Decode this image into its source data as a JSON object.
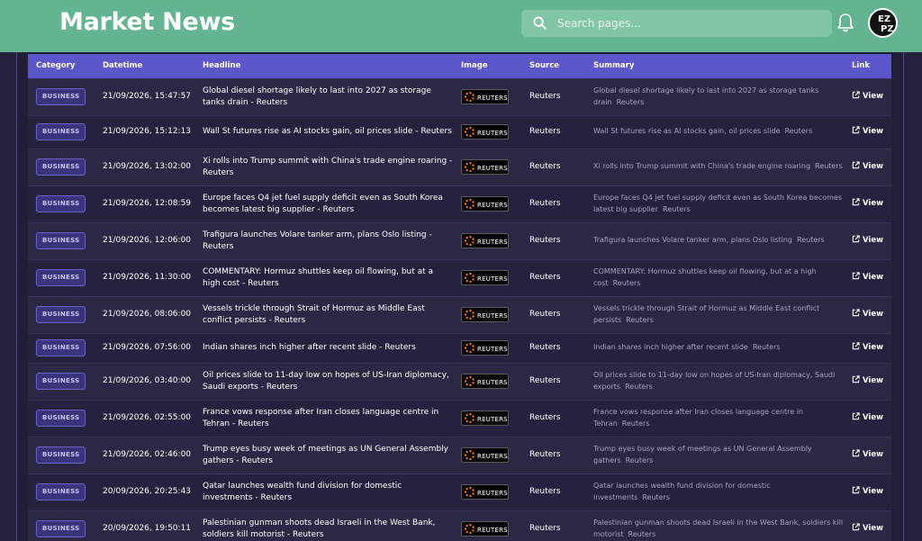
{
  "header": {
    "title": "Market News",
    "search_placeholder": "Search pages...",
    "avatar_line1": "EZ",
    "avatar_line2": "PZ"
  },
  "table": {
    "columns": [
      "Category",
      "Datetime",
      "Headline",
      "Image",
      "Source",
      "Summary",
      "Link"
    ],
    "rows": [
      {
        "category": "BUSINESS",
        "datetime": "21/09/2026, 15:47:57",
        "headline": "Global diesel shortage likely to last into 2027 as storage tanks drain - Reuters",
        "image": "REUTERS",
        "source": "Reuters",
        "summary": "Global diesel shortage likely to last into 2027 as storage tanks drain",
        "summary_source": "Reuters",
        "link": "View"
      },
      {
        "category": "BUSINESS",
        "datetime": "21/09/2026, 15:12:13",
        "headline": "Wall St futures rise as AI stocks gain, oil prices slide - Reuters",
        "image": "REUTERS",
        "source": "Reuters",
        "summary": "Wall St futures rise as AI stocks gain, oil prices slide",
        "summary_source": "Reuters",
        "link": "View"
      },
      {
        "category": "BUSINESS",
        "datetime": "21/09/2026, 13:02:00",
        "headline": "Xi rolls into Trump summit with China's trade engine roaring - Reuters",
        "image": "REUTERS",
        "source": "Reuters",
        "summary": "Xi rolls into Trump summit with China's trade engine roaring",
        "summary_source": "Reuters",
        "link": "View"
      },
      {
        "category": "BUSINESS",
        "datetime": "21/09/2026, 12:08:59",
        "headline": "Europe faces Q4 jet fuel supply deficit even as South Korea becomes latest big supplier - Reuters",
        "image": "REUTERS",
        "source": "Reuters",
        "summary": "Europe faces Q4 jet fuel supply deficit even as South Korea becomes latest big supplier",
        "summary_source": "Reuters",
        "link": "View"
      },
      {
        "category": "BUSINESS",
        "datetime": "21/09/2026, 12:06:00",
        "headline": "Trafigura launches Volare tanker arm, plans Oslo listing - Reuters",
        "image": "REUTERS",
        "source": "Reuters",
        "summary": "Trafigura launches Volare tanker arm, plans Oslo listing",
        "summary_source": "Reuters",
        "link": "View"
      },
      {
        "category": "BUSINESS",
        "datetime": "21/09/2026, 11:30:00",
        "headline": "COMMENTARY: Hormuz shuttles keep oil flowing, but at a high cost - Reuters",
        "image": "REUTERS",
        "source": "Reuters",
        "summary": "COMMENTARY: Hormuz shuttles keep oil flowing, but at a high cost",
        "summary_source": "Reuters",
        "link": "View"
      },
      {
        "category": "BUSINESS",
        "datetime": "21/09/2026, 08:06:00",
        "headline": "Vessels trickle through Strait of Hormuz as Middle East conflict persists - Reuters",
        "image": "REUTERS",
        "source": "Reuters",
        "summary": "Vessels trickle through Strait of Hormuz as Middle East conflict persists",
        "summary_source": "Reuters",
        "link": "View"
      },
      {
        "category": "BUSINESS",
        "datetime": "21/09/2026, 07:56:00",
        "headline": "Indian shares inch higher after recent slide - Reuters",
        "image": "REUTERS",
        "source": "Reuters",
        "summary": "Indian shares inch higher after recent slide",
        "summary_source": "Reuters",
        "link": "View"
      },
      {
        "category": "BUSINESS",
        "datetime": "21/09/2026, 03:40:00",
        "headline": "Oil prices slide to 11-day low on hopes of US-Iran diplomacy, Saudi exports - Reuters",
        "image": "REUTERS",
        "source": "Reuters",
        "summary": "Oil prices slide to 11-day low on hopes of US-Iran diplomacy, Saudi exports",
        "summary_source": "Reuters",
        "link": "View"
      },
      {
        "category": "BUSINESS",
        "datetime": "21/09/2026, 02:55:00",
        "headline": "France vows response after Iran closes language centre in Tehran - Reuters",
        "image": "REUTERS",
        "source": "Reuters",
        "summary": "France vows response after Iran closes language centre in Tehran",
        "summary_source": "Reuters",
        "link": "View"
      },
      {
        "category": "BUSINESS",
        "datetime": "21/09/2026, 02:46:00",
        "headline": "Trump eyes busy week of meetings as UN General Assembly gathers - Reuters",
        "image": "REUTERS",
        "source": "Reuters",
        "summary": "Trump eyes busy week of meetings as UN General Assembly gathers",
        "summary_source": "Reuters",
        "link": "View"
      },
      {
        "category": "BUSINESS",
        "datetime": "20/09/2026, 20:25:43",
        "headline": "Qatar launches wealth fund division for domestic investments - Reuters",
        "image": "REUTERS",
        "source": "Reuters",
        "summary": "Qatar launches wealth fund division for domestic investments",
        "summary_source": "Reuters",
        "link": "View"
      },
      {
        "category": "BUSINESS",
        "datetime": "20/09/2026, 19:50:11",
        "headline": "Palestinian gunman shoots dead Israeli in the West Bank, soldiers kill motorist - Reuters",
        "image": "REUTERS",
        "source": "Reuters",
        "summary": "Palestinian gunman shoots dead Israeli in the West Bank, soldiers kill motorist",
        "summary_source": "Reuters",
        "link": "View"
      }
    ]
  }
}
